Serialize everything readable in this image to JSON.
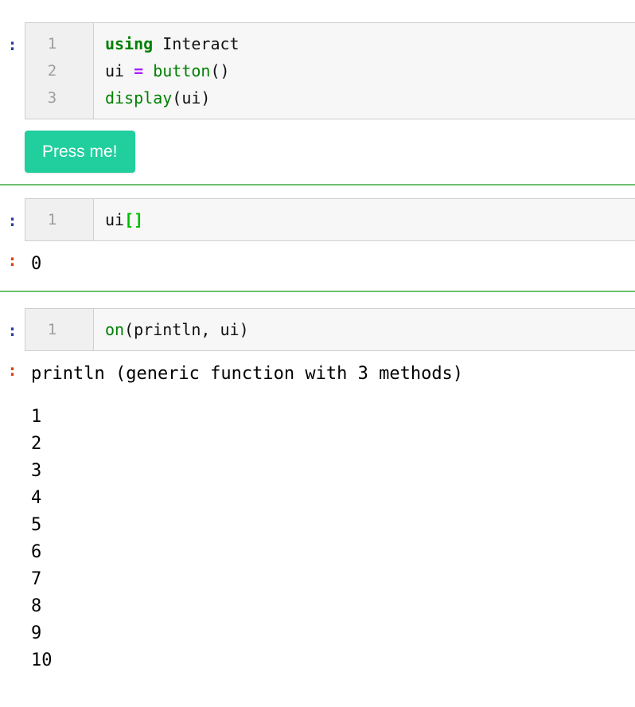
{
  "notebook": {
    "kernel_language": "julia",
    "input_prompt_symbol": ":",
    "output_prompt_symbol": ":",
    "colors": {
      "input_prompt": "#303f9f",
      "output_prompt": "#d84315",
      "cell_background": "#f7f7f7",
      "gutter_background": "#f0f0f0",
      "cell_border": "#cfcfcf",
      "separator": "#6cbf6c",
      "button_accent": "#21ce9e",
      "keyword": "#008000",
      "function": "#008000",
      "operator": "#aa22ff",
      "bracket": "#00bb00",
      "plain_text": "#111111"
    },
    "cells": [
      {
        "id": "cell-1",
        "type": "code",
        "prompt": ":",
        "line_numbers": [
          "1",
          "2",
          "3"
        ],
        "lines": [
          {
            "number": "1",
            "tokens": [
              {
                "text": "using",
                "kind": "keyword"
              },
              {
                "text": " Interact",
                "kind": "plain"
              }
            ]
          },
          {
            "number": "2",
            "tokens": [
              {
                "text": "ui ",
                "kind": "plain"
              },
              {
                "text": "=",
                "kind": "op"
              },
              {
                "text": " ",
                "kind": "plain"
              },
              {
                "text": "button",
                "kind": "func"
              },
              {
                "text": "()",
                "kind": "plain"
              }
            ]
          },
          {
            "number": "3",
            "tokens": [
              {
                "text": "display",
                "kind": "func"
              },
              {
                "text": "(ui)",
                "kind": "plain"
              }
            ]
          }
        ],
        "widget_output": {
          "type": "button",
          "label": "Press me!"
        }
      },
      {
        "id": "cell-2",
        "type": "code",
        "prompt": ":",
        "line_numbers": [
          "1"
        ],
        "lines": [
          {
            "number": "1",
            "tokens": [
              {
                "text": "ui",
                "kind": "plain"
              },
              {
                "text": "[]",
                "kind": "bracket"
              }
            ]
          }
        ],
        "result": {
          "prompt": ":",
          "text": "0"
        }
      },
      {
        "id": "cell-3",
        "type": "code",
        "prompt": ":",
        "line_numbers": [
          "1"
        ],
        "lines": [
          {
            "number": "1",
            "tokens": [
              {
                "text": "on",
                "kind": "func"
              },
              {
                "text": "(println, ui)",
                "kind": "plain"
              }
            ]
          }
        ],
        "result": {
          "prompt": ":",
          "text": "println (generic function with 3 methods)"
        },
        "stream_output": [
          "1",
          "2",
          "3",
          "4",
          "5",
          "6",
          "7",
          "8",
          "9",
          "10"
        ]
      }
    ]
  }
}
